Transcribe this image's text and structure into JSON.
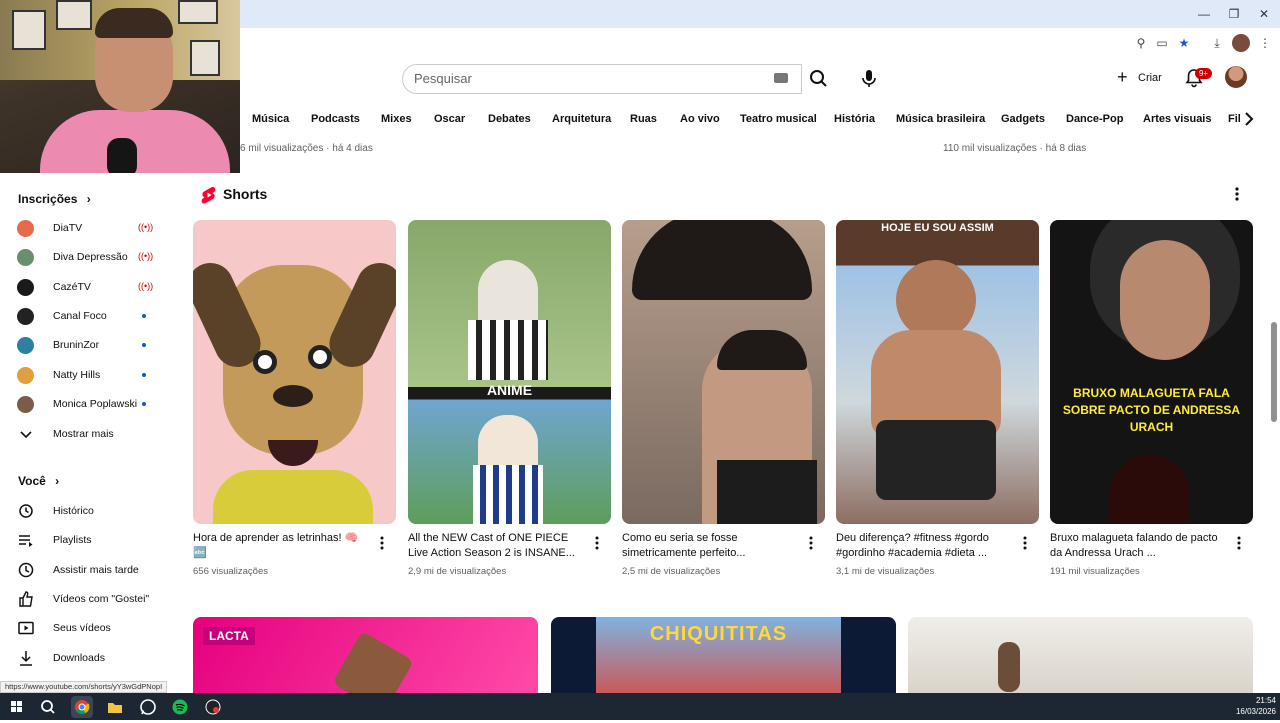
{
  "header": {
    "search_placeholder": "Pesquisar",
    "create_label": "Criar",
    "notifications_badge": "9+"
  },
  "chips": [
    "Música",
    "Podcasts",
    "Mixes",
    "Oscar",
    "Debates",
    "Arquitetura",
    "Ruas",
    "Ao vivo",
    "Teatro musical",
    "História",
    "Música brasileira",
    "Gadgets",
    "Dance-Pop",
    "Artes visuais",
    "Fil"
  ],
  "top_meta": {
    "left": "6 mil visualizações · há 4 dias",
    "right": "110 mil visualizações · há 8 dias"
  },
  "sidebar": {
    "subscriptions_title": "Inscrições",
    "subscriptions": [
      {
        "name": "DiaTV",
        "status": "live",
        "color": "#e76a4a"
      },
      {
        "name": "Diva Depressão",
        "status": "live",
        "color": "#6b8f6b"
      },
      {
        "name": "CazéTV",
        "status": "live",
        "color": "#1a1a1a"
      },
      {
        "name": "Canal Foco",
        "status": "new",
        "color": "#222222"
      },
      {
        "name": "BruninZor",
        "status": "new",
        "color": "#2d7fa3"
      },
      {
        "name": "Natty Hills",
        "status": "new",
        "color": "#e0a040"
      },
      {
        "name": "Monica Poplawski",
        "status": "new",
        "color": "#7a5c48"
      }
    ],
    "show_more": "Mostrar mais",
    "you_title": "Você",
    "you_items": [
      {
        "label": "Histórico",
        "icon": "history-icon"
      },
      {
        "label": "Playlists",
        "icon": "playlists-icon"
      },
      {
        "label": "Assistir mais tarde",
        "icon": "watch-later-icon"
      },
      {
        "label": "Vídeos com \"Gostei\"",
        "icon": "liked-icon"
      },
      {
        "label": "Seus vídeos",
        "icon": "your-videos-icon"
      },
      {
        "label": "Downloads",
        "icon": "downloads-icon"
      }
    ]
  },
  "shorts": {
    "title": "Shorts",
    "items": [
      {
        "title": "Hora de aprender as letrinhas! 🧠 🔤",
        "views": "656 visualizações",
        "overlay": ""
      },
      {
        "title": "All the NEW Cast of ONE PIECE Live Action Season 2 is INSANE...",
        "views": "2,9 mi de visualizações",
        "overlay": "ANIME"
      },
      {
        "title": "Como eu seria se fosse simetricamente perfeito...",
        "views": "2,5 mi de visualizações",
        "overlay": ""
      },
      {
        "title": "Deu diferença?  #fitness #gordo #gordinho #academia #dieta ...",
        "views": "3,1 mi de visualizações",
        "overlay": "HOJE EU SOU ASSIM"
      },
      {
        "title": "Bruxo malagueta falando de pacto da Andressa Urach ...",
        "views": "191 mil visualizações",
        "overlay": "BRUXO MALAGUETA FALA SOBRE PACTO DE ANDRESSA URACH"
      }
    ]
  },
  "bottom_thumbs": [
    {
      "label": "LACTA"
    },
    {
      "label": "CHIQUITITAS"
    },
    {
      "label": ""
    }
  ],
  "status_url": "https://www.youtube.com/shorts/yY3wGdPNopI",
  "clock": {
    "time": "21:54",
    "date": "16/03/2026"
  },
  "colors": {
    "brand_red": "#ff0033",
    "live_red": "#cc0000",
    "new_dot": "#065fd4"
  }
}
